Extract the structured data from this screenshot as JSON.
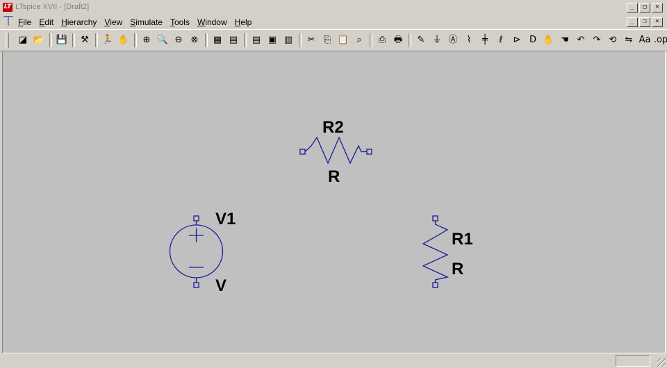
{
  "window": {
    "title": "LTspice XVII - [Draft2]",
    "logo": "LT"
  },
  "window_buttons": [
    "_",
    "□",
    "×"
  ],
  "mdi_buttons": [
    "_",
    "❐",
    "×"
  ],
  "menu": [
    "File",
    "Edit",
    "Hierarchy",
    "View",
    "Simulate",
    "Tools",
    "Window",
    "Help"
  ],
  "toolbar": [
    {
      "icon": "new-schematic-icon",
      "glyph": "◪"
    },
    {
      "icon": "open-icon",
      "glyph": "📂"
    },
    {
      "sep": true
    },
    {
      "icon": "save-icon",
      "glyph": "💾"
    },
    {
      "sep": true
    },
    {
      "icon": "control-panel-icon",
      "glyph": "⚒"
    },
    {
      "sep": true
    },
    {
      "icon": "run-icon",
      "glyph": "🏃"
    },
    {
      "icon": "halt-icon",
      "glyph": "✋"
    },
    {
      "sep": true
    },
    {
      "icon": "zoom-in-icon",
      "glyph": "⊕"
    },
    {
      "icon": "pan-icon",
      "glyph": "🔍"
    },
    {
      "icon": "zoom-out-icon",
      "glyph": "⊖"
    },
    {
      "icon": "zoom-fit-icon",
      "glyph": "⊗"
    },
    {
      "sep": true
    },
    {
      "icon": "autorange-icon",
      "glyph": "▦"
    },
    {
      "icon": "grid-icon",
      "glyph": "▤"
    },
    {
      "sep": true
    },
    {
      "icon": "tile-horizontal-icon",
      "glyph": "▤"
    },
    {
      "icon": "cascade-icon",
      "glyph": "▣"
    },
    {
      "icon": "tile-vertical-icon",
      "glyph": "▥"
    },
    {
      "sep": true
    },
    {
      "icon": "cut-icon",
      "glyph": "✂"
    },
    {
      "icon": "copy-icon",
      "glyph": "⎘"
    },
    {
      "icon": "paste-icon",
      "glyph": "📋"
    },
    {
      "icon": "find-icon",
      "glyph": "⌕"
    },
    {
      "sep": true
    },
    {
      "icon": "print-setup-icon",
      "glyph": "⎙"
    },
    {
      "icon": "print-icon",
      "glyph": "🖶"
    },
    {
      "sep": true
    },
    {
      "icon": "draw-wire-icon",
      "glyph": "✎"
    },
    {
      "icon": "ground-icon",
      "glyph": "⏚"
    },
    {
      "icon": "label-net-icon",
      "glyph": "Ⓐ"
    },
    {
      "icon": "resistor-icon",
      "glyph": "⌇"
    },
    {
      "icon": "capacitor-icon",
      "glyph": "╪"
    },
    {
      "icon": "inductor-icon",
      "glyph": "ℓ"
    },
    {
      "icon": "diode-icon",
      "glyph": "⊳"
    },
    {
      "icon": "component-icon",
      "glyph": "D"
    },
    {
      "icon": "move-icon",
      "glyph": "✋"
    },
    {
      "icon": "drag-icon",
      "glyph": "☚"
    },
    {
      "icon": "undo-icon",
      "glyph": "↶"
    },
    {
      "icon": "redo-icon",
      "glyph": "↷"
    },
    {
      "icon": "rotate-icon",
      "glyph": "⟲"
    },
    {
      "icon": "mirror-icon",
      "glyph": "⇋"
    },
    {
      "icon": "text-icon",
      "glyph": "Aa"
    },
    {
      "icon": "spice-directive-icon",
      "glyph": ".op"
    }
  ],
  "schematic": {
    "wire_color": "#1a1a99",
    "components": [
      {
        "name": "R2",
        "value": "R"
      },
      {
        "name": "V1",
        "value": "V"
      },
      {
        "name": "R1",
        "value": "R"
      }
    ]
  }
}
